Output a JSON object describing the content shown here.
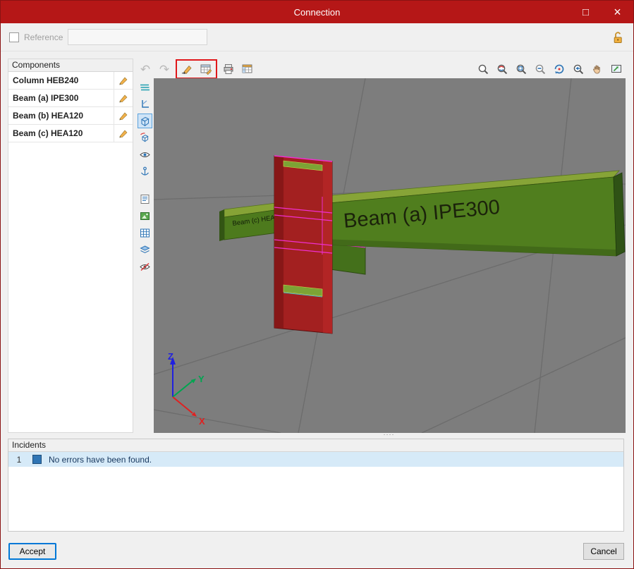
{
  "window": {
    "title": "Connection"
  },
  "titlebar_icons": {
    "maximize": "□",
    "close": "×"
  },
  "reference": {
    "label": "Reference",
    "value": ""
  },
  "components": {
    "header": "Components",
    "items": [
      {
        "label": "Column HEB240"
      },
      {
        "label": "Beam (a) IPE300"
      },
      {
        "label": "Beam (b) HEA120"
      },
      {
        "label": "Beam (c) HEA120"
      }
    ]
  },
  "toolbar": {
    "undo": "↶",
    "redo": "↷"
  },
  "viewport": {
    "beam_a_label": "Beam (a) IPE300",
    "beam_c_label": "Beam (c) HEA120",
    "axis_x": "X",
    "axis_y": "Y",
    "axis_z": "Z"
  },
  "splitter": {
    "dots": "····"
  },
  "incidents": {
    "header": "Incidents",
    "rows": [
      {
        "num": "1",
        "message": "No errors have been found."
      }
    ]
  },
  "footer": {
    "accept": "Accept",
    "cancel": "Cancel"
  },
  "colors": {
    "titlebar": "#b51717",
    "highlight_box": "#e0181b",
    "incident_row": "#d6eaf8",
    "incident_square": "#2f75b5",
    "viewport_bg": "#7d7d7d",
    "column_red": "#a32020",
    "beam_green": "#507e1e"
  }
}
